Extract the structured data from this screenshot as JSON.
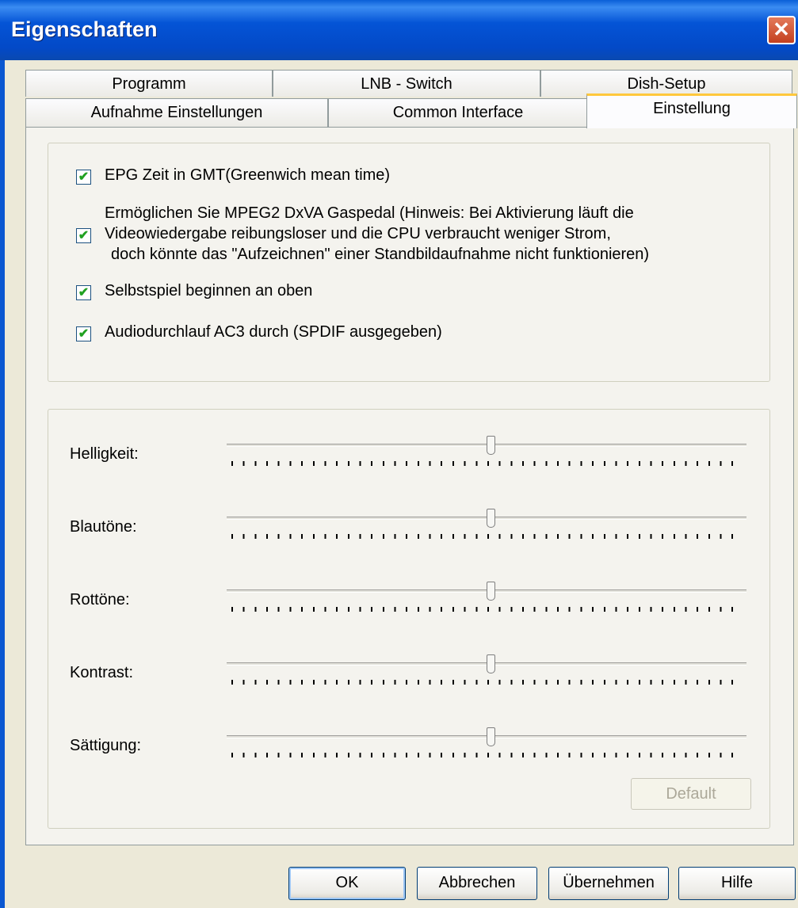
{
  "window": {
    "title": "Eigenschaften",
    "close_symbol": "✕"
  },
  "tabs": {
    "back_row": [
      {
        "label": "Programm"
      },
      {
        "label": "LNB - Switch"
      },
      {
        "label": "Dish-Setup"
      }
    ],
    "front_row": [
      {
        "label": "Aufnahme Einstellungen"
      },
      {
        "label": "Common Interface"
      },
      {
        "label": "Einstellung",
        "selected": true
      }
    ]
  },
  "options": {
    "epg_gmt": {
      "label": "EPG Zeit in GMT(Greenwich mean time)",
      "checked": true
    },
    "dxva": {
      "line1": "Ermöglichen Sie MPEG2 DxVA Gaspedal    (Hinweis: Bei Aktivierung läuft die",
      "line2": "Videowiedergabe reibungsloser und die CPU verbraucht weniger Strom,",
      "line3": "doch könnte das \"Aufzeichnen\" einer Standbildaufnahme nicht funktionieren)",
      "checked": true
    },
    "autoplay": {
      "label": "Selbstspiel beginnen an oben",
      "checked": true
    },
    "ac3": {
      "label": "Audiodurchlauf AC3 durch (SPDIF ausgegeben)",
      "checked": true
    }
  },
  "sliders": [
    {
      "label": "Helligkeit:",
      "value_fraction": 0.5
    },
    {
      "label": "Blautöne:",
      "value_fraction": 0.5
    },
    {
      "label": "Rottöne:",
      "value_fraction": 0.5
    },
    {
      "label": "Kontrast:",
      "value_fraction": 0.5
    },
    {
      "label": "Sättigung:",
      "value_fraction": 0.5
    }
  ],
  "default_button": {
    "label": "Default",
    "enabled": false
  },
  "buttons": {
    "ok": "OK",
    "cancel": "Abbrechen",
    "apply": "Übernehmen",
    "help": "Hilfe"
  },
  "colors": {
    "titlebar": "#0454d6",
    "face": "#ece9d8",
    "tab_highlight": "#ffc83c",
    "check": "#21a121"
  }
}
